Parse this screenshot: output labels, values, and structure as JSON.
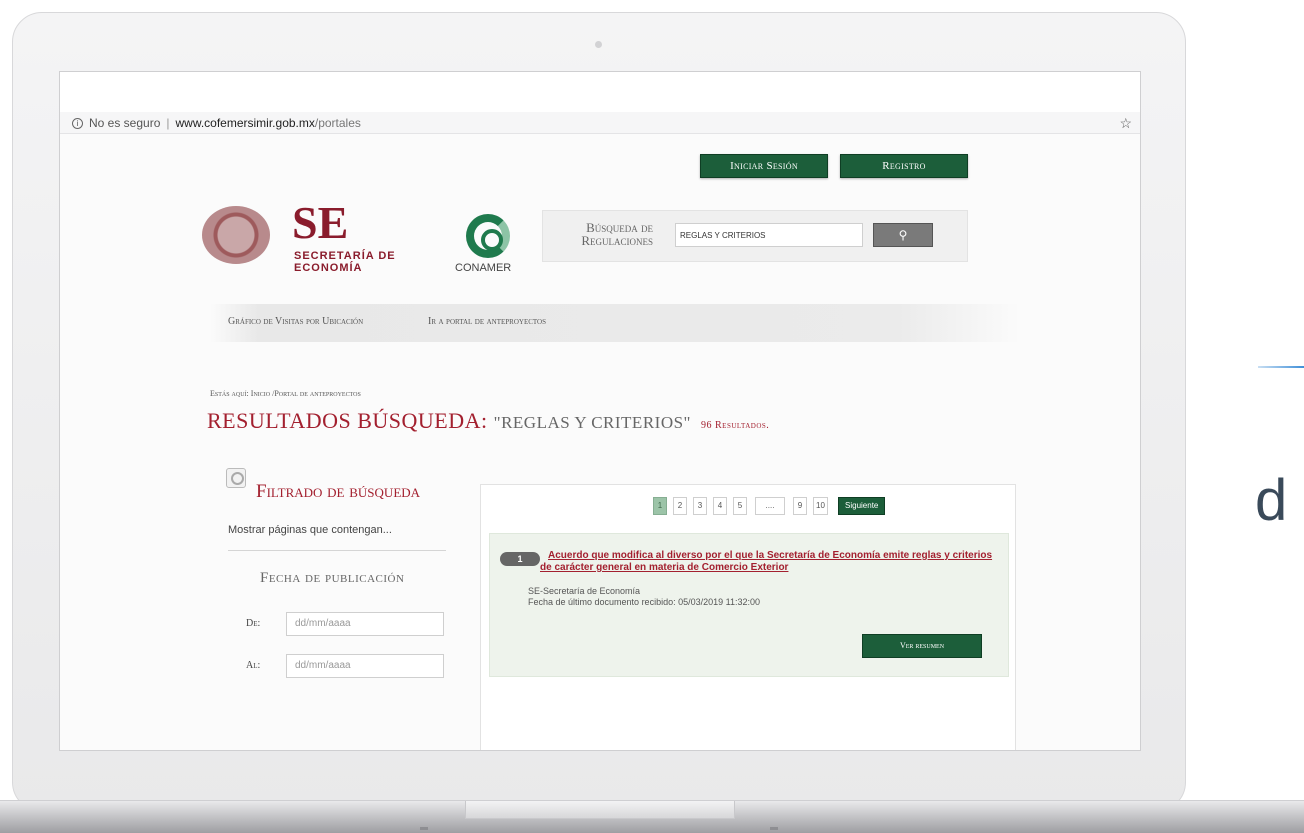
{
  "browser": {
    "security_label": "No es seguro",
    "url_host": "www.cofemersimir.gob.mx",
    "url_path": "/portales"
  },
  "header": {
    "login_label": "Iniciar Sesión",
    "register_label": "Registro",
    "se_logo_big": "SE",
    "se_logo_sub": "SECRETARÍA DE ECONOMÍA",
    "conamer_label": "CONAMER"
  },
  "search": {
    "label": "Búsqueda de Regulaciones",
    "value": "REGLAS Y CRITERIOS",
    "button_icon": "search-icon"
  },
  "nav": {
    "items": [
      "Gráfico de Visitas por Ubicación",
      "Ir a portal de anteproyectos"
    ]
  },
  "breadcrumb": "Estás aquí: Inicio /Portal de anteproyectos",
  "results": {
    "title": "RESULTADOS BÚSQUEDA:",
    "query": "\"REGLAS Y CRITERIOS\"",
    "count": "96 Resultados."
  },
  "filter": {
    "title": "Filtrado de búsqueda",
    "subtitle": "Mostrar páginas que contengan...",
    "date_title": "Fecha de publicación",
    "from_label": "De:",
    "to_label": "Al:",
    "date_placeholder": "dd/mm/aaaa"
  },
  "pagination": {
    "pages": [
      "1",
      "2",
      "3",
      "4",
      "5",
      "....",
      "9",
      "10"
    ],
    "active": "1",
    "next_label": "Siguiente →"
  },
  "result_items": [
    {
      "number": "1",
      "title": "Acuerdo que modifica al diverso por el que la Secretaría de Economía emite reglas y criterios de carácter general en materia de Comercio Exterior",
      "agency": "SE-Secretaría de Economía",
      "last_doc": "Fecha de último documento recibido: 05/03/2019 11:32:00",
      "summary_button": "Ver resumen"
    }
  ],
  "decor": {
    "side_letter": "d"
  },
  "colors": {
    "brand_red": "#a3202f",
    "brand_green": "#1c5e3a"
  }
}
